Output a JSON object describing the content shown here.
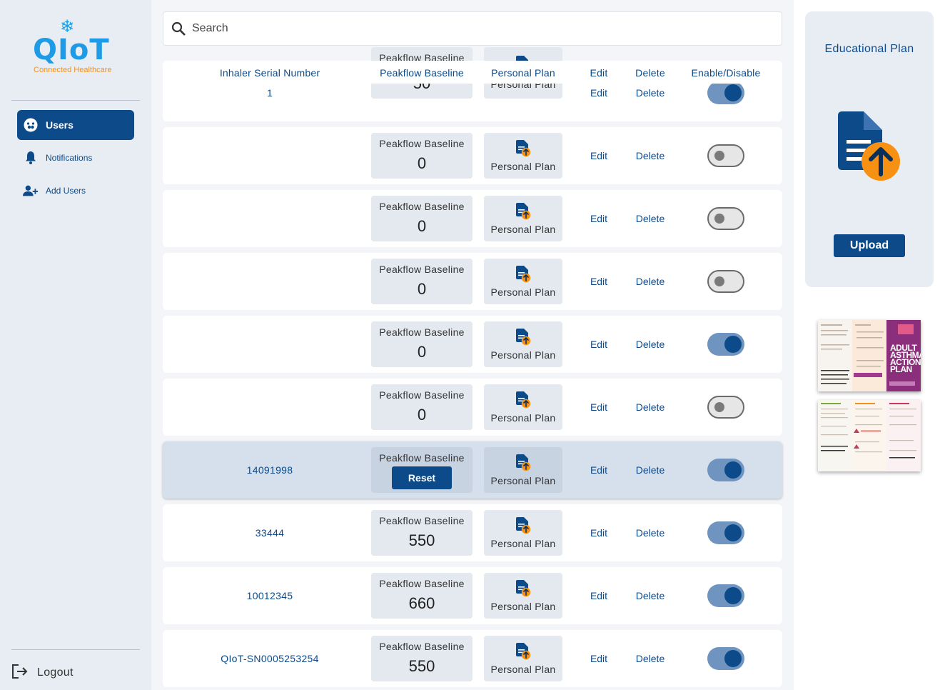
{
  "app": {
    "logo_text": "QIoT",
    "logo_subtitle": "Connected Healthcare",
    "brand_color": "#1e9be6",
    "accent_color": "#f0921e",
    "primary_color": "#0c4a8a"
  },
  "sidebar": {
    "items": [
      {
        "label": "Users",
        "icon": "users-face-icon",
        "active": true
      },
      {
        "label": "Notifications",
        "icon": "bell-icon",
        "active": false
      },
      {
        "label": "Add Users",
        "icon": "add-user-icon",
        "active": false
      }
    ],
    "logout_label": "Logout"
  },
  "search": {
    "placeholder": "Search",
    "value": ""
  },
  "table": {
    "headers": [
      "Inhaler Serial Number",
      "Peakflow Baseline",
      "Personal Plan",
      "Edit",
      "Delete",
      "Enable/Disable"
    ],
    "rows": [
      {
        "serial": "1",
        "pf_label": "Peakflow Baseline",
        "pf_value": "50",
        "pp_label": "Personal Plan",
        "edit": "Edit",
        "delete": "Delete",
        "enabled": true
      },
      {
        "serial": "",
        "pf_label": "Peakflow Baseline",
        "pf_value": "0",
        "pp_label": "Personal Plan",
        "edit": "Edit",
        "delete": "Delete",
        "enabled": false
      },
      {
        "serial": "",
        "pf_label": "Peakflow Baseline",
        "pf_value": "0",
        "pp_label": "Personal Plan",
        "edit": "Edit",
        "delete": "Delete",
        "enabled": false
      },
      {
        "serial": "",
        "pf_label": "Peakflow Baseline",
        "pf_value": "0",
        "pp_label": "Personal Plan",
        "edit": "Edit",
        "delete": "Delete",
        "enabled": false
      },
      {
        "serial": "",
        "pf_label": "Peakflow Baseline",
        "pf_value": "0",
        "pp_label": "Personal Plan",
        "edit": "Edit",
        "delete": "Delete",
        "enabled": true
      },
      {
        "serial": "",
        "pf_label": "Peakflow Baseline",
        "pf_value": "0",
        "pp_label": "Personal Plan",
        "edit": "Edit",
        "delete": "Delete",
        "enabled": false
      },
      {
        "serial": "14091998",
        "pf_label": "Peakflow Baseline",
        "pf_value": "",
        "reset_label": "Reset",
        "pp_label": "Personal Plan",
        "edit": "Edit",
        "delete": "Delete",
        "enabled": true,
        "selected": true
      },
      {
        "serial": "33444",
        "pf_label": "Peakflow Baseline",
        "pf_value": "550",
        "pp_label": "Personal Plan",
        "edit": "Edit",
        "delete": "Delete",
        "enabled": true
      },
      {
        "serial": "10012345",
        "pf_label": "Peakflow Baseline",
        "pf_value": "660",
        "pp_label": "Personal Plan",
        "edit": "Edit",
        "delete": "Delete",
        "enabled": true
      },
      {
        "serial": "QIoT-SN0005253254",
        "pf_label": "Peakflow Baseline",
        "pf_value": "550",
        "pp_label": "Personal Plan",
        "edit": "Edit",
        "delete": "Delete",
        "enabled": true
      }
    ]
  },
  "educational_plan": {
    "title": "Educational Plan",
    "upload_label": "Upload",
    "thumbnail_title": "ADULT ASTHMA ACTION PLAN"
  }
}
